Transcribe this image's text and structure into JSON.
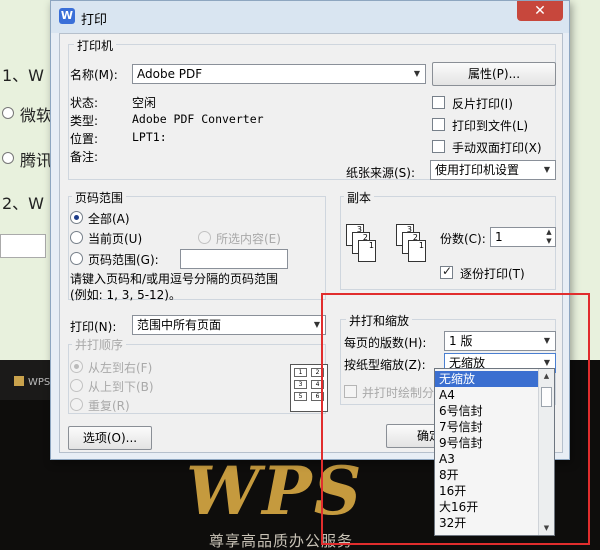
{
  "background": {
    "line1": "1、W",
    "opt1": "微软",
    "opt2": "腾讯",
    "line2": "2、W",
    "wps_bar": "WPS",
    "wps_logo": "WPS",
    "slogan": "尊享高品质办公服务"
  },
  "dialog": {
    "title": "打印",
    "close_icon": "close-icon",
    "printer": {
      "group_title": "打印机",
      "name_label": "名称(M):",
      "name_value": "Adobe PDF",
      "properties_button": "属性(P)...",
      "status_label": "状态:",
      "status_value": "空闲",
      "type_label": "类型:",
      "type_value": "Adobe PDF Converter",
      "location_label": "位置:",
      "location_value": "LPT1:",
      "comment_label": "备注:",
      "reverse_print": "反片打印(I)",
      "print_to_file": "打印到文件(L)",
      "manual_duplex": "手动双面打印(X)",
      "paper_source_label": "纸张来源(S):",
      "paper_source_value": "使用打印机设置"
    },
    "page_range": {
      "group_title": "页码范围",
      "all": "全部(A)",
      "current_page": "当前页(U)",
      "selection": "所选内容(E)",
      "page_range": "页码范围(G):",
      "page_range_value": "",
      "hint_line1": "请键入页码和/或用逗号分隔的页码范围",
      "hint_line2": "(例如: 1, 3, 5-12)。"
    },
    "copies": {
      "group_title": "副本",
      "copies_label": "份数(C):",
      "copies_value": "1",
      "collate": "逐份打印(T)"
    },
    "print_what": {
      "label": "打印(N):",
      "value": "范围中所有页面"
    },
    "order": {
      "group_title": "并打顺序",
      "left_to_right": "从左到右(F)",
      "top_to_bottom": "从上到下(B)",
      "repeat": "重复(R)"
    },
    "zoom": {
      "group_title": "并打和缩放",
      "pages_per_sheet_label": "每页的版数(H):",
      "pages_per_sheet_value": "1 版",
      "scale_label": "按纸型缩放(Z):",
      "scale_value": "无缩放",
      "draw_borders": "并打时绘制分",
      "options": [
        "无缩放",
        "A4",
        "6号信封",
        "7号信封",
        "9号信封",
        "A3",
        "8开",
        "16开",
        "大16开",
        "32开"
      ]
    },
    "options_button": "选项(O)...",
    "ok_button": "确定"
  }
}
